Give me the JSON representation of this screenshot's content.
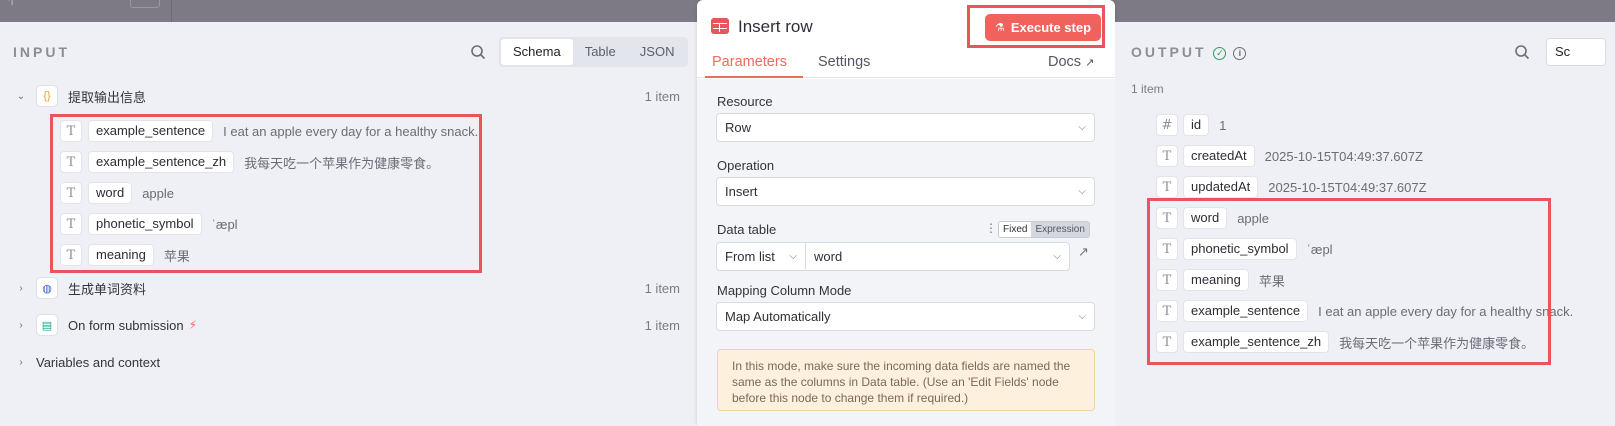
{
  "input": {
    "title": "INPUT",
    "view_tabs": [
      "Schema",
      "Table",
      "JSON"
    ],
    "tree": [
      {
        "label": "提取输出信息",
        "count": "1 item",
        "expanded": true,
        "icon": "braces-icon",
        "fields": [
          {
            "name": "example_sentence",
            "value": "I eat an apple every day for a healthy snack."
          },
          {
            "name": "example_sentence_zh",
            "value": "我每天吃一个苹果作为健康零食。"
          },
          {
            "name": "word",
            "value": "apple"
          },
          {
            "name": "phonetic_symbol",
            "value": "ˈæpl"
          },
          {
            "name": "meaning",
            "value": "苹果"
          }
        ]
      },
      {
        "label": "生成单词资料",
        "count": "1 item",
        "icon": "globe-icon"
      },
      {
        "label": "On form submission",
        "count": "1 item",
        "icon": "form-icon",
        "badge": "bolt-icon"
      },
      {
        "label": "Variables and context"
      }
    ]
  },
  "modal": {
    "title": "Insert row",
    "execute_label": "Execute step",
    "tabs": [
      "Parameters",
      "Settings"
    ],
    "docs_label": "Docs",
    "resource": {
      "label": "Resource",
      "value": "Row"
    },
    "operation": {
      "label": "Operation",
      "value": "Insert"
    },
    "data_table": {
      "label": "Data table",
      "mode_fixed": "Fixed",
      "mode_expression": "Expression",
      "source": "From list",
      "value": "word"
    },
    "mapping": {
      "label": "Mapping Column Mode",
      "value": "Map Automatically"
    },
    "notice": "In this mode, make sure the incoming data fields are named the same as the columns in Data table. (Use an 'Edit Fields' node before this node to change them if required.)"
  },
  "output": {
    "title": "OUTPUT",
    "count": "1 item",
    "view_tab_partial": "Sc",
    "fields": [
      {
        "name": "id",
        "value": "1",
        "type": "number"
      },
      {
        "name": "createdAt",
        "value": "2025-10-15T04:49:37.607Z",
        "type": "text"
      },
      {
        "name": "updatedAt",
        "value": "2025-10-15T04:49:37.607Z",
        "type": "text"
      },
      {
        "name": "word",
        "value": "apple",
        "type": "text"
      },
      {
        "name": "phonetic_symbol",
        "value": "ˈæpl",
        "type": "text"
      },
      {
        "name": "meaning",
        "value": "苹果",
        "type": "text"
      },
      {
        "name": "example_sentence",
        "value": "I eat an apple every day for a healthy snack.",
        "type": "text"
      },
      {
        "name": "example_sentence_zh",
        "value": "我每天吃一个苹果作为健康零食。",
        "type": "text"
      }
    ]
  },
  "colors": {
    "accent": "#ec6c5e",
    "execute": "#f1625c",
    "highlight": "#e8555b",
    "success": "#2f9e5a"
  }
}
